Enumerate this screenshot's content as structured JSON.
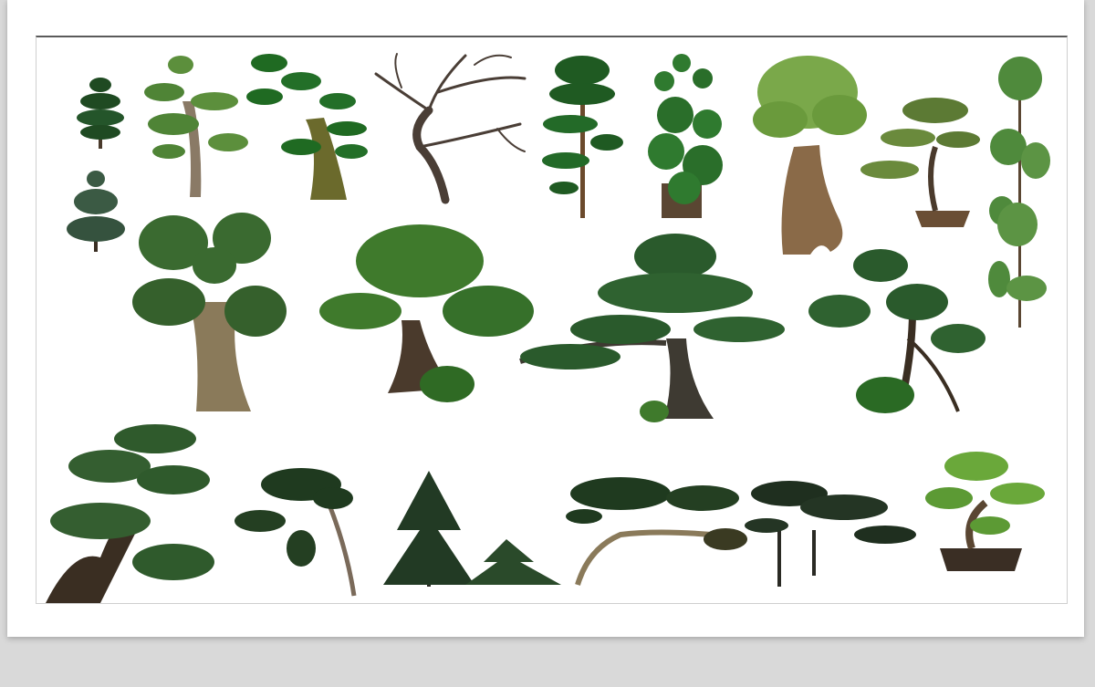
{
  "colors": {
    "background": "#d9d9d9",
    "paper": "#ffffff",
    "frame_top_border": "#5a5a5a",
    "foliage_dark": "#1f3a1f",
    "foliage_mid": "#2f5e2a",
    "foliage_light": "#5c8f3c",
    "trunk": "#5a4632",
    "pot": "#4a3a2c"
  },
  "icons": [
    "small-conifer-icon",
    "pom-pom-pine-icon",
    "cloud-pruned-tree-icon",
    "bare-tree-icon",
    "layered-topiary-icon",
    "clustered-topiary-icon",
    "broadleaf-tree-icon",
    "potted-bonsai-icon",
    "tall-pom-pom-icon",
    "twin-trunk-tree-icon",
    "large-bonsai-tree-icon",
    "spreading-pine-icon",
    "root-over-rock-pine-icon",
    "black-pine-icon",
    "leaning-pine-icon",
    "fir-silhouette-icon",
    "flat-top-pine-icon",
    "umbrella-pine-icon",
    "potted-pine-bonsai-icon"
  ]
}
